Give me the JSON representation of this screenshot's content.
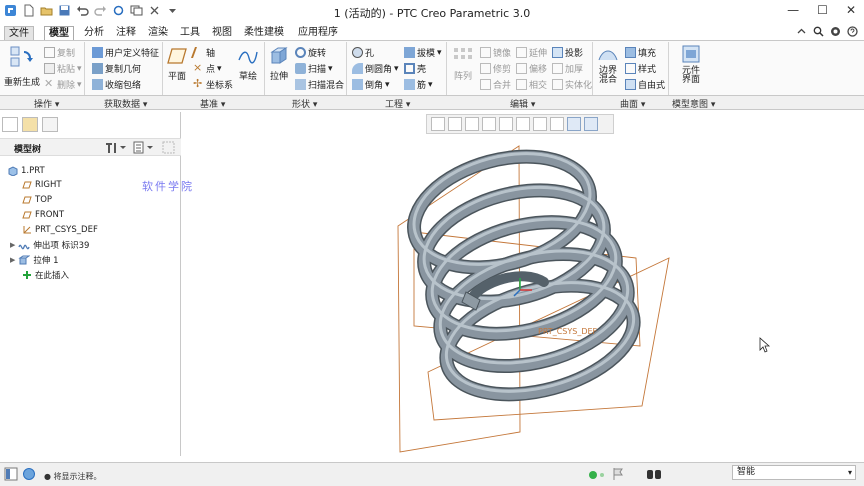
{
  "window": {
    "title": "1 (活动的) - PTC Creo Parametric 3.0",
    "controls": [
      "—",
      "☐",
      "✕"
    ]
  },
  "tabs": [
    "文件",
    "模型",
    "分析",
    "注释",
    "渲染",
    "工具",
    "视图",
    "柔性建模",
    "应用程序"
  ],
  "active_tab": "模型",
  "ribbon": {
    "regen": "重新生成",
    "ops": {
      "copy": "复制",
      "paste": "粘贴",
      "delete": "删除"
    },
    "get": {
      "udf": "用户定义特征",
      "copygeom": "复制几何",
      "shrinkwrap": "收缩包络"
    },
    "datum": {
      "plane": "平面",
      "axis": "轴",
      "point": "点",
      "csys": "坐标系",
      "sketch": "草绘"
    },
    "shape": {
      "extrude": "拉伸",
      "revolve": "旋转",
      "sweep": "扫描",
      "sweepblend": "扫描混合"
    },
    "eng": {
      "hole": "孔",
      "round": "倒圆角",
      "chamfer": "倒角",
      "draft": "拔模",
      "shell": "壳",
      "rib": "筋"
    },
    "edit": {
      "pattern": "阵列",
      "mirror": "镜像",
      "trim": "修剪",
      "merge": "合并",
      "extend": "延伸",
      "offset": "偏移",
      "intersect": "相交",
      "project": "投影",
      "thicken": "加厚",
      "solidify": "实体化"
    },
    "surface": {
      "boundary": "边界\n混合",
      "fill": "填充",
      "style": "样式",
      "freestyle": "自由式"
    },
    "intent": {
      "component": "元件\n界面"
    }
  },
  "groups": [
    "操作 ▾",
    "获取数据 ▾",
    "基准 ▾",
    "形状 ▾",
    "工程 ▾",
    "编辑 ▾",
    "曲面 ▾",
    "模型意图 ▾"
  ],
  "tree": {
    "title": "模型树",
    "items": [
      "1.PRT",
      "RIGHT",
      "TOP",
      "FRONT",
      "PRT_CSYS_DEF",
      "伸出项 标识39",
      "拉伸 1",
      "在此插入"
    ]
  },
  "watermark": "软件学院",
  "status": {
    "message": "● 将显示注释。",
    "filter": "智能"
  },
  "colors": {
    "accent": "#2a6fc0",
    "spring": "#7d8a93",
    "datum": "#c4773a"
  }
}
